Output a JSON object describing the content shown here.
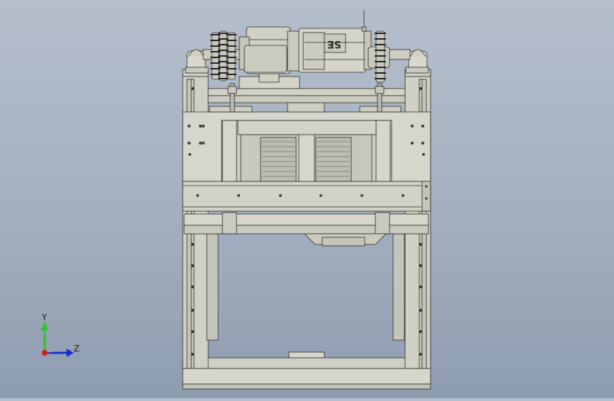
{
  "viewport": {
    "background_top": "#b5bfcc",
    "background_bottom": "#8e9cb0",
    "part_fill": "#d6d6cc",
    "part_shade": "#c3c3b8",
    "edge_color": "#2a2a2a"
  },
  "motor": {
    "brand_label": "SE"
  },
  "triad": {
    "y_label": "Y",
    "z_label": "Z",
    "y_color": "#2ec52e",
    "z_color": "#1c2bd8",
    "x_color": "#d81c1c"
  }
}
